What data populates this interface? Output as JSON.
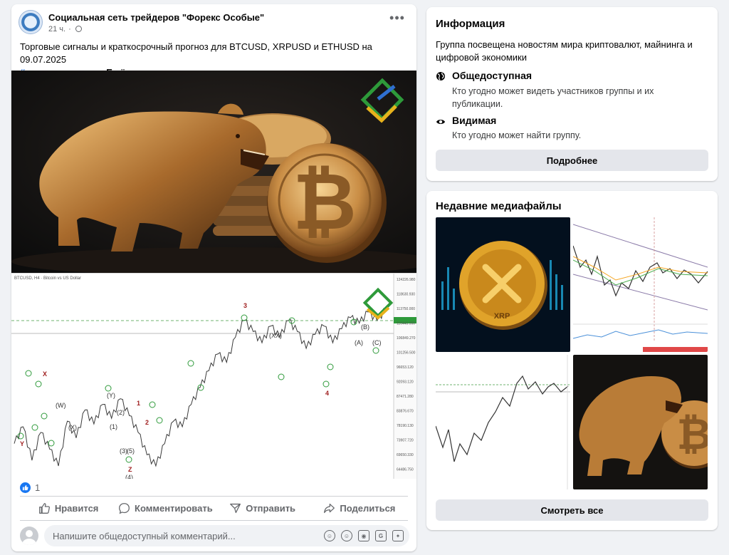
{
  "post": {
    "group_name": "Социальная сеть трейдеров \"Форекс Особые\"",
    "time": "21 ч.",
    "text": "Торговые сигналы и краткосрочный прогноз для BTCUSD, XRPUSD и ETHUSD на 09.07.2025",
    "hashtag": "#криптовалюты",
    "ellipsis": ",...",
    "more": "Ещё",
    "reaction_count": "1",
    "actions": {
      "like": "Нравится",
      "comment": "Комментировать",
      "send": "Отправить",
      "share": "Поделиться"
    },
    "comment_placeholder": "Напишите общедоступный комментарий..."
  },
  "chart_data": {
    "type": "line",
    "title": "BTCUSD, H4 · Bitcoin vs US Dollar",
    "xlabel": "",
    "ylabel": "",
    "y_ticks": [
      "124226.980",
      "118630.930",
      "113750.000",
      "110443.550",
      "106849.270",
      "101256.500",
      "96653.120",
      "92093.120",
      "87471.280",
      "83876.670",
      "78190.130",
      "73907.720",
      "69650.330",
      "64486.750"
    ],
    "wave_labels": [
      "3",
      "X",
      "Y",
      "1",
      "2",
      "4",
      "Z",
      "(W)",
      "(X)",
      "(Y)",
      "(XX)",
      "(A)",
      "(B)",
      "(C)",
      "(1)",
      "(2)",
      "(3)",
      "(4)",
      "(5)"
    ],
    "series": [
      {
        "values": [
          70,
          76,
          64,
          74,
          68,
          62,
          78,
          72,
          82,
          77,
          84,
          79,
          86,
          80,
          74,
          66,
          62,
          70,
          78,
          76,
          84,
          90,
          96,
          102,
          99,
          108,
          114,
          110,
          106,
          112,
          108,
          114,
          110,
          104,
          109,
          112,
          106,
          111,
          115,
          113,
          117,
          114,
          118
        ]
      }
    ]
  },
  "info": {
    "title": "Информация",
    "description": "Группа посвещена новостям мира криптовалют, майнинга и цифровой экономики",
    "items": [
      {
        "title": "Общедоступная",
        "text": "Кто угодно может видеть участников группы и их публикации."
      },
      {
        "title": "Видимая",
        "text": "Кто угодно может найти группу."
      }
    ],
    "button": "Подробнее"
  },
  "media": {
    "title": "Недавние медиафайлы",
    "xrp_label": "XRP",
    "button": "Смотреть все"
  },
  "colors": {
    "accent": "#216fdb",
    "like": "#1877f2",
    "chart_line": "#3a3a3a",
    "wave_green": "#2e9a3a",
    "wave_red": "#a02020"
  }
}
